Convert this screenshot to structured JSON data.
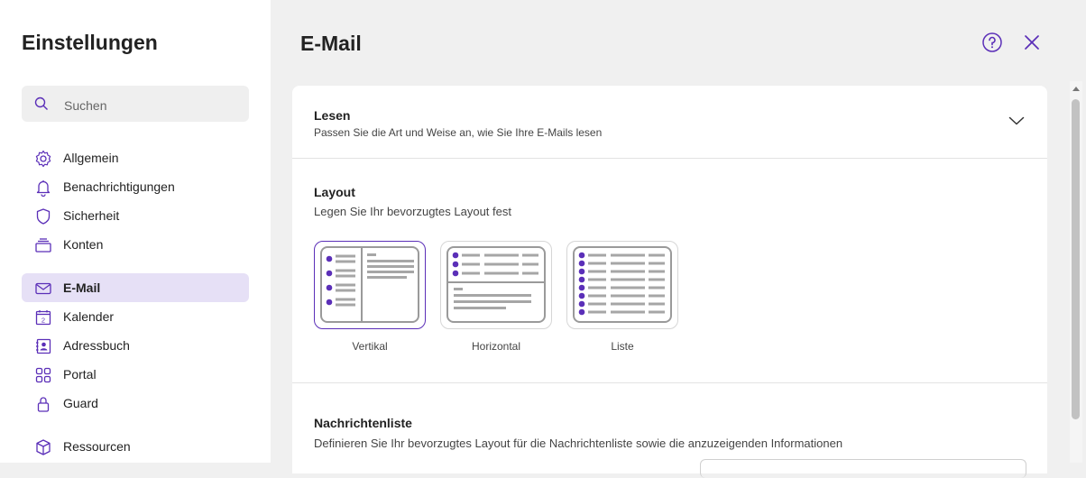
{
  "sidebar": {
    "title": "Einstellungen",
    "search_placeholder": "Suchen",
    "items": [
      {
        "label": "Allgemein",
        "icon": "gear-icon"
      },
      {
        "label": "Benachrichtigungen",
        "icon": "bell-icon"
      },
      {
        "label": "Sicherheit",
        "icon": "shield-icon"
      },
      {
        "label": "Konten",
        "icon": "accounts-icon"
      },
      {
        "label": "E-Mail",
        "icon": "mail-icon",
        "active": true
      },
      {
        "label": "Kalender",
        "icon": "calendar-icon",
        "calendar_day": "2"
      },
      {
        "label": "Adressbuch",
        "icon": "address-book-icon"
      },
      {
        "label": "Portal",
        "icon": "grid-icon"
      },
      {
        "label": "Guard",
        "icon": "lock-icon"
      },
      {
        "label": "Ressourcen",
        "icon": "cube-icon"
      }
    ]
  },
  "main": {
    "title": "E-Mail",
    "help_icon": "help-icon",
    "close_icon": "close-icon",
    "lesen": {
      "title": "Lesen",
      "description": "Passen Sie die Art und Weise an, wie Sie Ihre E-Mails lesen"
    },
    "layout": {
      "title": "Layout",
      "description": "Legen Sie Ihr bevorzugtes Layout fest",
      "options": [
        {
          "label": "Vertikal",
          "selected": true
        },
        {
          "label": "Horizontal",
          "selected": false
        },
        {
          "label": "Liste",
          "selected": false
        }
      ]
    },
    "nachrichtenliste": {
      "title": "Nachrichtenliste",
      "description": "Definieren Sie Ihr bevorzugtes Layout für die Nachrichtenliste sowie die anzuzeigenden Informationen"
    }
  },
  "colors": {
    "accent": "#5b2fb8",
    "active_bg": "#e6e0f6"
  }
}
